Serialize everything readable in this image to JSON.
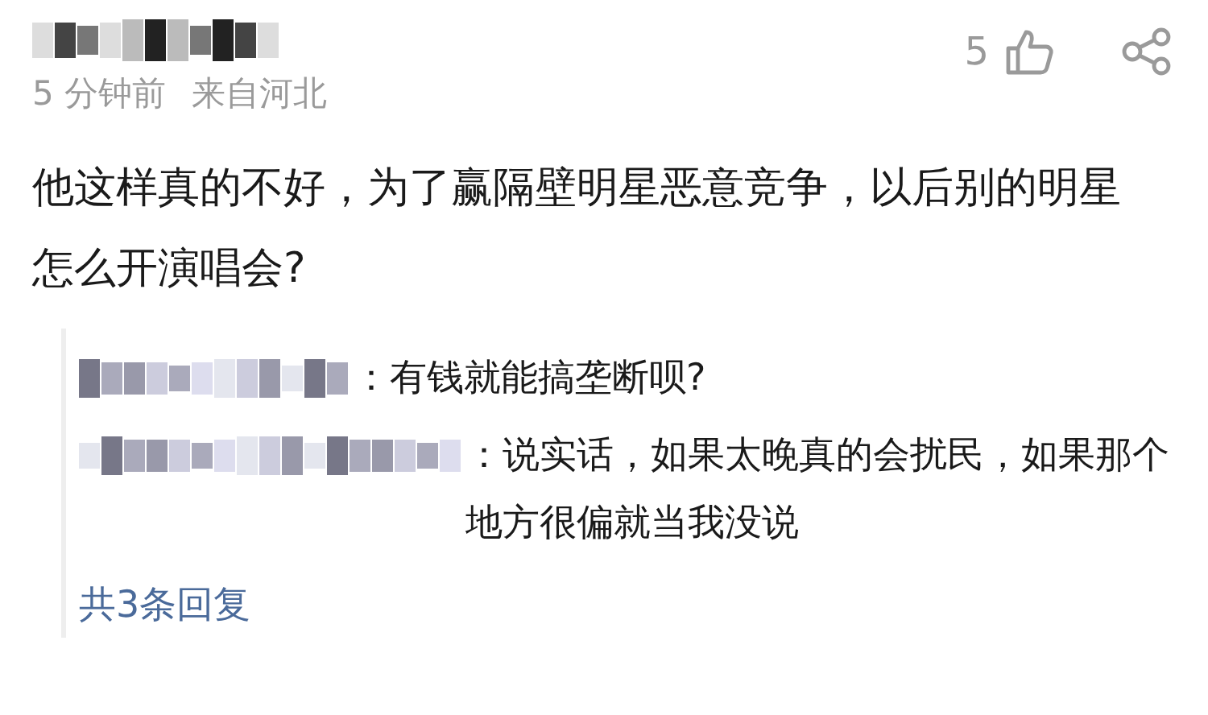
{
  "comment": {
    "time": "5 分钟前",
    "location": "来自河北",
    "likes": "5",
    "text": "他这样真的不好，为了赢隔壁明星恶意竞争，以后别的明星怎么开演唱会?"
  },
  "replies": [
    {
      "text": "：有钱就能搞垄断呗?"
    },
    {
      "text": "：说实话，如果太晚真的会扰民，如果那个地方很偏就当我没说"
    }
  ],
  "more_replies": "共3条回复"
}
